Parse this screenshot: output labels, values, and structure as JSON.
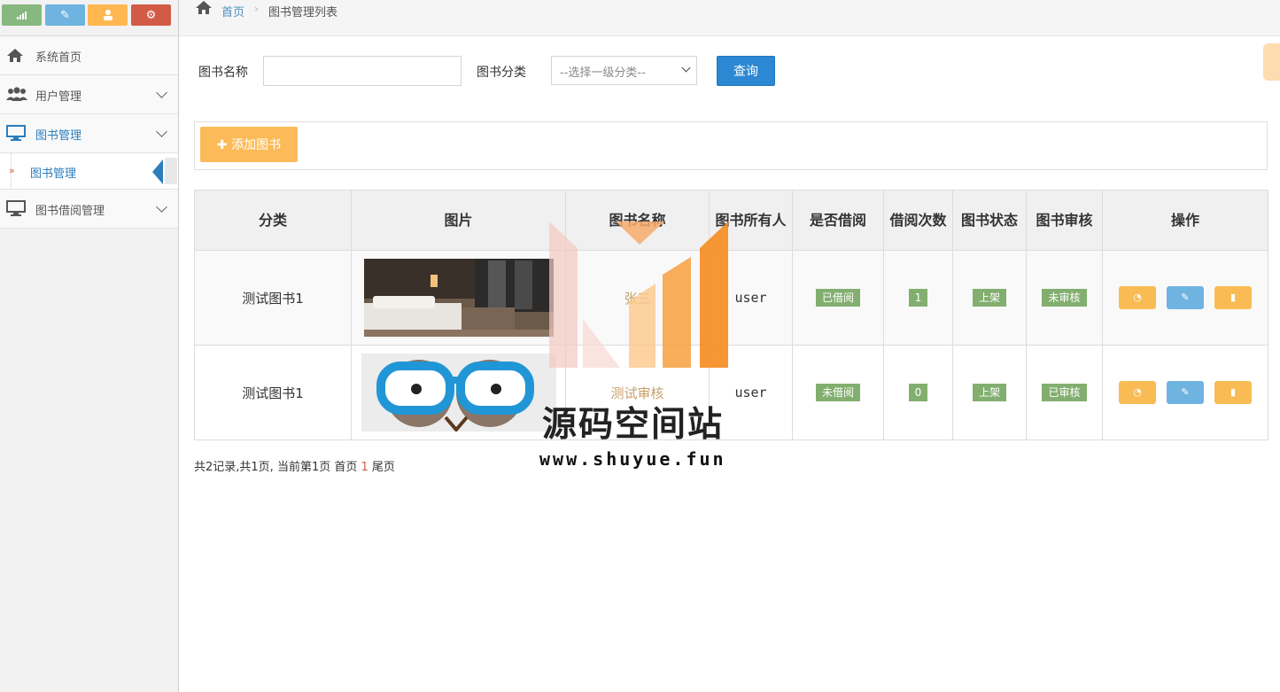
{
  "sidebar": {
    "shortcuts": [
      {
        "icon": "signal-icon",
        "color": "#87b87f"
      },
      {
        "icon": "pencil-icon",
        "color": "#6fb3e0"
      },
      {
        "icon": "users-icon",
        "color": "#ffb752"
      },
      {
        "icon": "cogs-icon",
        "color": "#d15b47"
      }
    ],
    "items": [
      {
        "label": "系统首页",
        "icon": "home-icon"
      },
      {
        "label": "用户管理",
        "icon": "users-icon"
      },
      {
        "label": "图书管理",
        "icon": "desktop-icon"
      },
      {
        "label": "图书借阅管理",
        "icon": "desktop-icon"
      }
    ],
    "sub_items": [
      {
        "label": "图书管理"
      }
    ]
  },
  "breadcrumb": {
    "home": "首页",
    "current": "图书管理列表"
  },
  "search": {
    "name_label": "图书名称",
    "name_value": "",
    "category_label": "图书分类",
    "category_selected": "--选择一级分类--",
    "button": "查询"
  },
  "toolbar": {
    "add_button": "✚ 添加图书"
  },
  "table": {
    "headers": [
      "分类",
      "图片",
      "图书名称",
      "图书所有人",
      "是否借阅",
      "借阅次数",
      "图书状态",
      "图书审核",
      "操作"
    ],
    "rows": [
      {
        "category": "测试图书1",
        "image": "hotel-room",
        "name": "张三",
        "owner": "user",
        "borrowed": "已借阅",
        "count": "1",
        "status": "上架",
        "audit": "未审核"
      },
      {
        "category": "测试图书1",
        "image": "owl-glasses",
        "name": "测试审核",
        "owner": "user",
        "borrowed": "未借阅",
        "count": "0",
        "status": "上架",
        "audit": "已审核"
      }
    ]
  },
  "pager": {
    "pre": "共2记录,共1页, 当前第1页 首页 ",
    "current": "1",
    "post": " 尾页"
  },
  "watermark": {
    "title": "源码空间站",
    "url": "www.shuyue.fun"
  }
}
